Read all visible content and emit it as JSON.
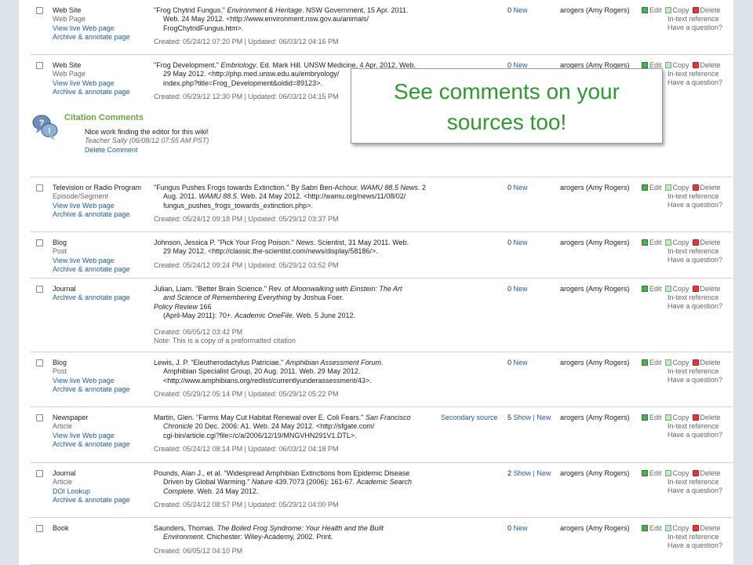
{
  "sources": [
    {
      "type": "Web Site",
      "subtype": "Web Page",
      "links": [
        "View live Web page",
        "Archive & annotate page"
      ],
      "citation": [
        {
          "parts": [
            {
              "t": "\"Frog Chytrid Fungus.\" "
            },
            {
              "t": "Environment & Heritage",
              "i": true
            },
            {
              "t": ". NSW Government, 15 Apr. 2011."
            }
          ]
        },
        {
          "parts": [
            {
              "t": "Web. 24 May 2012. <http://www.environment.nsw.gov.au/animals/"
            }
          ]
        },
        {
          "parts": [
            {
              "t": "FrogChytridFungus.htm>."
            }
          ]
        }
      ],
      "meta": "Created: 05/24/12 07:20 PM | Updated: 06/03/12 04:16 PM",
      "comments_count": "0",
      "comments_links": [
        "New"
      ],
      "secondary": "",
      "owner": "arogers (Amy Rogers)"
    },
    {
      "type": "Web Site",
      "subtype": "Web Page",
      "links": [
        "View live Web page",
        "Archive & annotate page"
      ],
      "citation": [
        {
          "parts": [
            {
              "t": "\"Frog Development.\" "
            },
            {
              "t": "Embriology",
              "i": true
            },
            {
              "t": ". Ed. Mark Hill. UNSW Medicine, 4 Apr. 2012. Web."
            }
          ]
        },
        {
          "parts": [
            {
              "t": "29 May 2012. <http://php.med.unsw.edu.au/embryology/"
            }
          ]
        },
        {
          "parts": [
            {
              "t": "index.php?title=Frog_Development&oldid=89123>."
            }
          ]
        }
      ],
      "meta": "Created: 05/29/12 12:30 PM | Updated: 06/03/12 04:15 PM",
      "comments_count": "0",
      "comments_links": [
        "New"
      ],
      "secondary": "",
      "owner": "arogers (Amy Rogers)"
    },
    {
      "type": "Television or Radio Program",
      "subtype": "Episode/Segment",
      "links": [
        "View live Web page",
        "Archive & annotate page"
      ],
      "citation": [
        {
          "parts": [
            {
              "t": "\"Fungus Pushes Frogs towards Extinction.\" By Sabri Ben-Achour. "
            },
            {
              "t": "WAMU 88.5 News",
              "i": true
            },
            {
              "t": ". 2"
            }
          ]
        },
        {
          "parts": [
            {
              "t": "Aug. 2011. "
            },
            {
              "t": "WAMU 88.5",
              "i": true
            },
            {
              "t": ". Web. 24 May 2012. <http://wamu.org/news/11/08/02/"
            }
          ]
        },
        {
          "parts": [
            {
              "t": "fungus_pushes_frogs_towards_extinction.php>."
            }
          ]
        }
      ],
      "meta": "Created: 05/24/12 09:18 PM | Updated: 05/29/12 03:37 PM",
      "comments_count": "0",
      "comments_links": [
        "New"
      ],
      "secondary": "",
      "owner": "arogers (Amy Rogers)"
    },
    {
      "type": "Blog",
      "subtype": "Post",
      "links": [
        "View live Web page",
        "Archive & annotate page"
      ],
      "citation": [
        {
          "parts": [
            {
              "t": "Johnson, Jessica P. \"Pick Your Frog Poison.\" "
            },
            {
              "t": "News",
              "i": true
            },
            {
              "t": ". Scientist, 31 May 2011. Web."
            }
          ]
        },
        {
          "parts": [
            {
              "t": "29 May 2012. <http://classic.the-scientist.com/news/display/58186/>."
            }
          ]
        }
      ],
      "meta": "Created: 05/24/12 09:24 PM | Updated: 05/29/12 03:52 PM",
      "comments_count": "0",
      "comments_links": [
        "New"
      ],
      "secondary": "",
      "owner": "arogers (Amy Rogers)"
    },
    {
      "type": "Journal",
      "subtype": "",
      "links": [
        "Archive & annotate page"
      ],
      "citation": [
        {
          "parts": [
            {
              "t": "Julian, Liam. \"Better Brain Science.\" Rev. of "
            },
            {
              "t": "Moonwalking with Einstein: The Art",
              "i": true
            }
          ]
        },
        {
          "parts": [
            {
              "t": "and Science of Remembering Everything",
              "i": true
            },
            {
              "t": " by Joshua Foer."
            }
          ]
        },
        {
          "parts": [
            {
              "t": "Policy Review",
              "i": true
            },
            {
              "t": " 166"
            }
          ],
          "flush": true
        },
        {
          "parts": [
            {
              "t": "(April-May 2011): 70+. "
            },
            {
              "t": "Academic OneFile",
              "i": true
            },
            {
              "t": ". Web. 5 June 2012."
            }
          ]
        }
      ],
      "meta": "Created: 06/05/12 03:42 PM",
      "note": "Note: This is a copy of a preformatted citation",
      "comments_count": "0",
      "comments_links": [
        "New"
      ],
      "secondary": "",
      "owner": "arogers (Amy Rogers)"
    },
    {
      "type": "Blog",
      "subtype": "Post",
      "links": [
        "View live Web page",
        "Archive & annotate page"
      ],
      "citation": [
        {
          "parts": [
            {
              "t": "Lewis, J. P. \"Eleutherodactylus Patriciae.\" "
            },
            {
              "t": "Amphibian Assessment Forum",
              "i": true
            },
            {
              "t": "."
            }
          ]
        },
        {
          "parts": [
            {
              "t": "Amphibian Specialist Group, 20 Aug. 2011. Web. 29 May 2012."
            }
          ]
        },
        {
          "parts": [
            {
              "t": "<http://www.amphibians.org/redlist/currentlyunderassessment/43>."
            }
          ]
        }
      ],
      "meta": "Created: 05/29/12 05:14 PM | Updated: 05/29/12 05:22 PM",
      "comments_count": "0",
      "comments_links": [
        "New"
      ],
      "secondary": "",
      "owner": "arogers (Amy Rogers)"
    },
    {
      "type": "Newspaper",
      "subtype": "Article",
      "links": [
        "View live Web page",
        "Archive & annotate page"
      ],
      "citation": [
        {
          "parts": [
            {
              "t": "Martin, Glen. \"Farms May Cut Habitat Renewal over E. Coli Fears.\" "
            },
            {
              "t": "San Francisco",
              "i": true
            }
          ]
        },
        {
          "parts": [
            {
              "t": "Chronicle",
              "i": true
            },
            {
              "t": " 20 Dec. 2006: A1. Web. 24 May 2012. <http://sfgate.com/"
            }
          ]
        },
        {
          "parts": [
            {
              "t": "cgi-bin/article.cgi?file=/c/a/2006/12/19/MNGVHN291V1.DTL>."
            }
          ]
        }
      ],
      "meta": "Created: 05/24/12 08:14 PM | Updated: 06/03/12 04:18 PM",
      "comments_count": "5",
      "comments_links": [
        "Show",
        "New"
      ],
      "secondary": "Secondary source",
      "owner": "arogers (Amy Rogers)"
    },
    {
      "type": "Journal",
      "subtype": "Article",
      "links": [
        "DOI Lookup",
        "Archive & annotate page"
      ],
      "citation": [
        {
          "parts": [
            {
              "t": "Pounds, Alan J., et al. \"Widespread Amphibian Extinctions from Epidemic Disease"
            }
          ]
        },
        {
          "parts": [
            {
              "t": "Driven by Global Warming.\" "
            },
            {
              "t": "Nature",
              "i": true
            },
            {
              "t": " 439.7073 (2006): 161-67. "
            },
            {
              "t": "Academic Search",
              "i": true
            }
          ]
        },
        {
          "parts": [
            {
              "t": "Complete",
              "i": true
            },
            {
              "t": ". Web. 24 May 2012."
            }
          ]
        }
      ],
      "meta": "Created: 05/24/12 08:57 PM | Updated: 05/29/12 04:00 PM",
      "comments_count": "2",
      "comments_links": [
        "Show",
        "New"
      ],
      "secondary": "",
      "owner": "arogers (Amy Rogers)"
    },
    {
      "type": "Book",
      "subtype": "",
      "links": [],
      "citation": [
        {
          "parts": [
            {
              "t": "Saunders, Thomas. "
            },
            {
              "t": "The Boiled Frog Syndrome: Your Health and the Built",
              "i": true
            }
          ]
        },
        {
          "parts": [
            {
              "t": "Environment",
              "i": true
            },
            {
              "t": ". Chichester: Wiley-Academy, 2002. Print."
            }
          ]
        }
      ],
      "meta": "Created: 06/05/12 04:10 PM",
      "comments_count": "0",
      "comments_links": [
        "New"
      ],
      "secondary": "",
      "owner": "arogers (Amy Rogers)"
    }
  ],
  "actions": {
    "edit": "Edit",
    "copy": "Copy",
    "delete": "Delete",
    "intext": "In-text reference",
    "question": "Have a question?"
  },
  "citation_comments": {
    "title": "Citation Comments",
    "text": "Nice work finding the editor for this wiki!",
    "byline": "Teacher Sally (06/08/12 07:55 AM PST)",
    "delete": "Delete Comment"
  },
  "callout": {
    "lines": [
      "See comments on your",
      "sources too!"
    ]
  },
  "colors": {
    "link": "#1c5ca8",
    "callout_text": "#2e9a2e",
    "comments_title": "#6aa63a",
    "frame": "#dde3ea"
  }
}
